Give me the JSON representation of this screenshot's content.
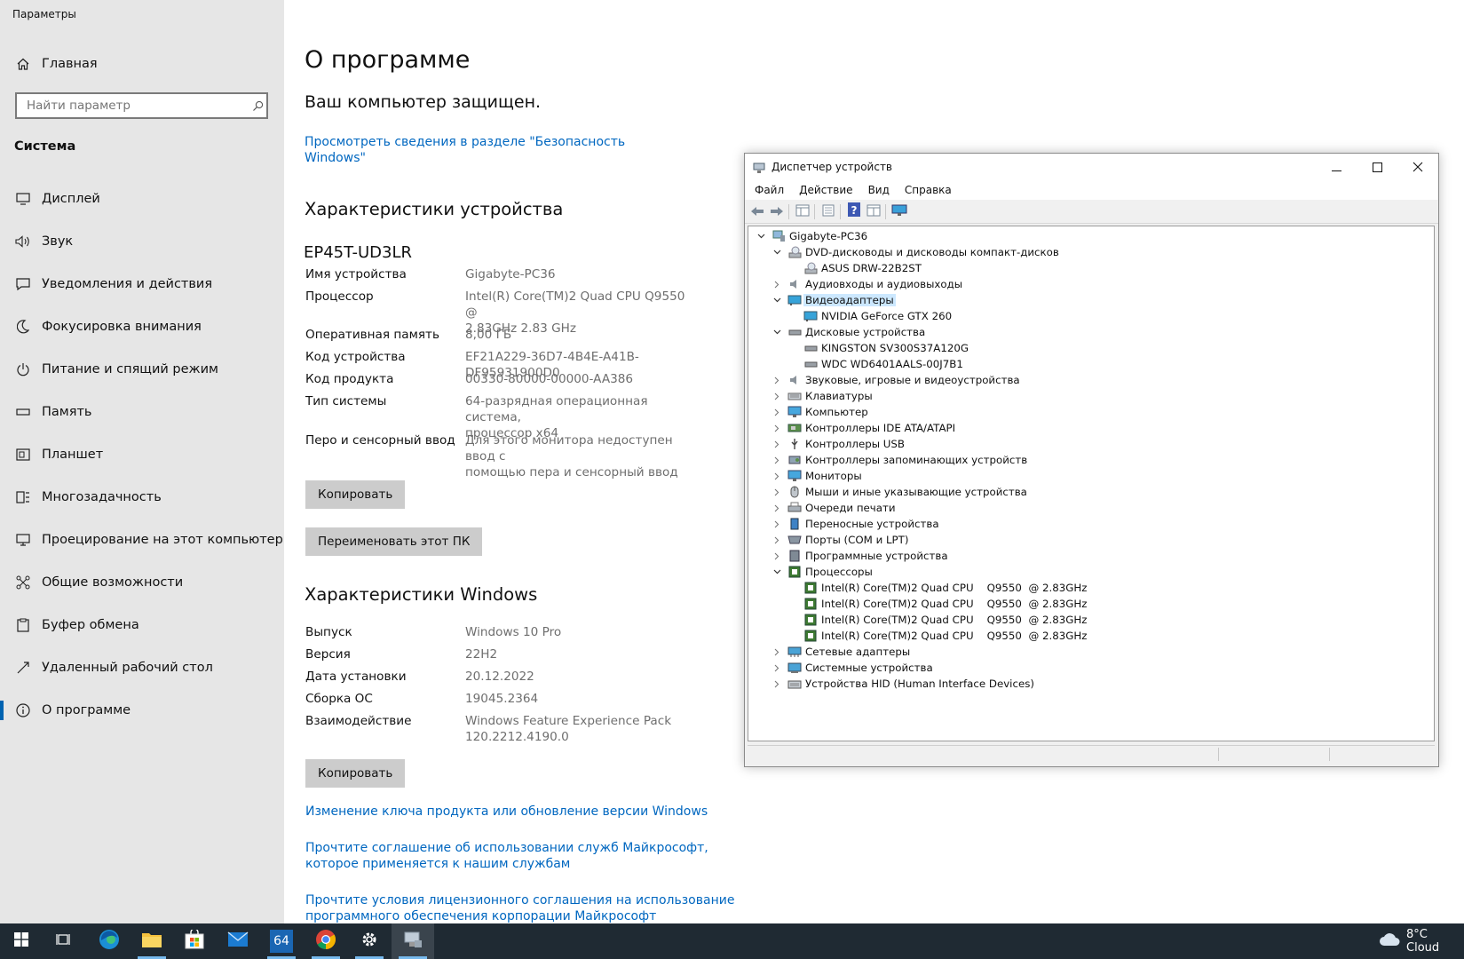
{
  "settings": {
    "title": "Параметры",
    "home_label": "Главная",
    "search_placeholder": "Найти параметр",
    "section": "Система",
    "nav": [
      {
        "label": "Дисплей",
        "icon": "display-icon"
      },
      {
        "label": "Звук",
        "icon": "speaker-icon"
      },
      {
        "label": "Уведомления и действия",
        "icon": "notification-icon"
      },
      {
        "label": "Фокусировка внимания",
        "icon": "moon-icon"
      },
      {
        "label": "Питание и спящий режим",
        "icon": "power-icon"
      },
      {
        "label": "Память",
        "icon": "storage-icon"
      },
      {
        "label": "Планшет",
        "icon": "tablet-icon"
      },
      {
        "label": "Многозадачность",
        "icon": "multitasking-icon"
      },
      {
        "label": "Проецирование на этот компьютер",
        "icon": "projection-icon"
      },
      {
        "label": "Общие возможности",
        "icon": "shared-experiences-icon"
      },
      {
        "label": "Буфер обмена",
        "icon": "clipboard-icon"
      },
      {
        "label": "Удаленный рабочий стол",
        "icon": "remote-desktop-icon"
      },
      {
        "label": "О программе",
        "icon": "info-icon",
        "active": true
      }
    ]
  },
  "about": {
    "title": "О программе",
    "protected": "Ваш компьютер защищен.",
    "security_link_line1": "Просмотреть сведения в разделе \"Безопасность",
    "security_link_line2": "Windows\"",
    "device_specs_heading": "Характеристики устройства",
    "model": "EP45T-UD3LR",
    "device_specs": [
      {
        "key": "Имя устройства",
        "value": "Gigabyte-PC36"
      },
      {
        "key": "Процессор",
        "value": "Intel(R) Core(TM)2 Quad CPU    Q9550  @",
        "value2": "2.83GHz   2.83 GHz"
      },
      {
        "key": "Оперативная память",
        "value": "8,00 ГБ"
      },
      {
        "key": "Код устройства",
        "value": "EF21A229-36D7-4B4E-A41B-DF95931900D0"
      },
      {
        "key": "Код продукта",
        "value": "00330-80000-00000-AA386"
      },
      {
        "key": "Тип системы",
        "value": "64-разрядная операционная система,",
        "value2": "процессор x64"
      },
      {
        "key": "Перо и сенсорный ввод",
        "value": "Для этого монитора недоступен ввод с",
        "value2": "помощью пера и сенсорный ввод"
      }
    ],
    "copy_label": "Копировать",
    "rename_label": "Переименовать этот ПК",
    "windows_specs_heading": "Характеристики Windows",
    "windows_specs": [
      {
        "key": "Выпуск",
        "value": "Windows 10 Pro"
      },
      {
        "key": "Версия",
        "value": "22H2"
      },
      {
        "key": "Дата установки",
        "value": "20.12.2022"
      },
      {
        "key": "Сборка ОС",
        "value": "19045.2364"
      },
      {
        "key": "Взаимодействие",
        "value": "Windows Feature Experience Pack",
        "value2": "120.2212.4190.0"
      }
    ],
    "copy2_label": "Копировать",
    "link_product_key": "Изменение ключа продукта или обновление версии Windows",
    "link_services_1": "Прочтите соглашение об использовании служб Майкрософт,",
    "link_services_2": "которое применяется к нашим службам",
    "link_license_1": "Прочтите условия лицензионного соглашения на использование",
    "link_license_2": "программного обеспечения корпорации Майкрософт"
  },
  "device_manager": {
    "title": "Диспетчер устройств",
    "menu": [
      "Файл",
      "Действие",
      "Вид",
      "Справка"
    ],
    "tree": [
      {
        "label": "Gigabyte-PC36",
        "level": 0,
        "expander": "open",
        "icon": "computer-icon"
      },
      {
        "label": "DVD-дисководы и дисководы компакт-дисков",
        "level": 1,
        "expander": "open",
        "icon": "dvd-drive-icon"
      },
      {
        "label": "ASUS DRW-22B2ST",
        "level": 2,
        "expander": "none",
        "icon": "dvd-drive-icon"
      },
      {
        "label": "Аудиовходы и аудиовыходы",
        "level": 1,
        "expander": "closed",
        "icon": "speaker-icon"
      },
      {
        "label": "Видеоадаптеры",
        "level": 1,
        "expander": "open",
        "icon": "display-adapter-icon",
        "selected": true
      },
      {
        "label": "NVIDIA GeForce GTX 260",
        "level": 2,
        "expander": "none",
        "icon": "display-adapter-icon"
      },
      {
        "label": "Дисковые устройства",
        "level": 1,
        "expander": "open",
        "icon": "disk-drive-icon"
      },
      {
        "label": "KINGSTON SV300S37A120G",
        "level": 2,
        "expander": "none",
        "icon": "disk-drive-icon"
      },
      {
        "label": "WDC WD6401AALS-00J7B1",
        "level": 2,
        "expander": "none",
        "icon": "disk-drive-icon"
      },
      {
        "label": "Звуковые, игровые и видеоустройства",
        "level": 1,
        "expander": "closed",
        "icon": "speaker-icon"
      },
      {
        "label": "Клавиатуры",
        "level": 1,
        "expander": "closed",
        "icon": "keyboard-icon"
      },
      {
        "label": "Компьютер",
        "level": 1,
        "expander": "closed",
        "icon": "monitor-icon"
      },
      {
        "label": "Контроллеры IDE ATA/ATAPI",
        "level": 1,
        "expander": "closed",
        "icon": "ide-controller-icon"
      },
      {
        "label": "Контроллеры USB",
        "level": 1,
        "expander": "closed",
        "icon": "usb-icon"
      },
      {
        "label": "Контроллеры запоминающих устройств",
        "level": 1,
        "expander": "closed",
        "icon": "storage-controller-icon"
      },
      {
        "label": "Мониторы",
        "level": 1,
        "expander": "closed",
        "icon": "monitor-icon"
      },
      {
        "label": "Мыши и иные указывающие устройства",
        "level": 1,
        "expander": "closed",
        "icon": "mouse-icon"
      },
      {
        "label": "Очереди печати",
        "level": 1,
        "expander": "closed",
        "icon": "printer-icon"
      },
      {
        "label": "Переносные устройства",
        "level": 1,
        "expander": "closed",
        "icon": "portable-device-icon"
      },
      {
        "label": "Порты (COM и LPT)",
        "level": 1,
        "expander": "closed",
        "icon": "port-icon"
      },
      {
        "label": "Программные устройства",
        "level": 1,
        "expander": "closed",
        "icon": "software-device-icon"
      },
      {
        "label": "Процессоры",
        "level": 1,
        "expander": "open",
        "icon": "processor-icon"
      },
      {
        "label": "Intel(R) Core(TM)2 Quad CPU    Q9550  @ 2.83GHz",
        "level": 2,
        "expander": "none",
        "icon": "processor-icon"
      },
      {
        "label": "Intel(R) Core(TM)2 Quad CPU    Q9550  @ 2.83GHz",
        "level": 2,
        "expander": "none",
        "icon": "processor-icon"
      },
      {
        "label": "Intel(R) Core(TM)2 Quad CPU    Q9550  @ 2.83GHz",
        "level": 2,
        "expander": "none",
        "icon": "processor-icon"
      },
      {
        "label": "Intel(R) Core(TM)2 Quad CPU    Q9550  @ 2.83GHz",
        "level": 2,
        "expander": "none",
        "icon": "processor-icon"
      },
      {
        "label": "Сетевые адаптеры",
        "level": 1,
        "expander": "closed",
        "icon": "network-adapter-icon"
      },
      {
        "label": "Системные устройства",
        "level": 1,
        "expander": "closed",
        "icon": "system-device-icon"
      },
      {
        "label": "Устройства HID (Human Interface Devices)",
        "level": 1,
        "expander": "closed",
        "icon": "hid-icon"
      }
    ]
  },
  "taskbar": {
    "apps": [
      "start-icon",
      "task-view-icon",
      "edge-icon",
      "file-explorer-icon",
      "store-icon",
      "mail-icon",
      "aida64-icon",
      "chrome-icon",
      "settings-icon",
      "device-manager-icon"
    ],
    "aida_label": "64",
    "weather": "8°C  Cloud",
    "accent": "#0063b1"
  }
}
